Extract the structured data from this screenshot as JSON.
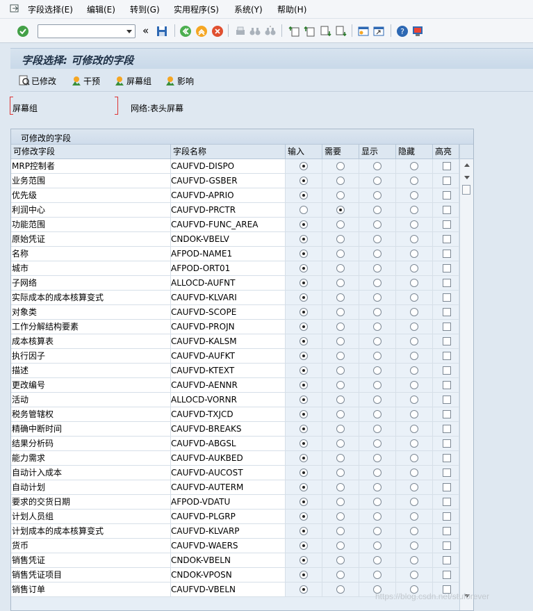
{
  "menubar": {
    "items": [
      "字段选择(E)",
      "编辑(E)",
      "转到(G)",
      "实用程序(S)",
      "系统(Y)",
      "帮助(H)"
    ]
  },
  "toolbar": {
    "command_value": ""
  },
  "title": "字段选择: 可修改的字段",
  "app_toolbar": {
    "items": [
      "已修改",
      "干预",
      "屏幕组",
      "影响"
    ]
  },
  "field": {
    "label": "屏幕组",
    "value": "网络:表头屏幕"
  },
  "table": {
    "group_title": "可修改的字段",
    "columns": [
      "可修改字段",
      "字段名称",
      "输入",
      "需要",
      "显示",
      "隐藏",
      "高亮"
    ],
    "rows": [
      {
        "desc": "MRP控制者",
        "name": "CAUFVD-DISPO",
        "sel": "input",
        "highlight": false
      },
      {
        "desc": "业务范围",
        "name": "CAUFVD-GSBER",
        "sel": "input",
        "highlight": false
      },
      {
        "desc": "优先级",
        "name": "CAUFVD-APRIO",
        "sel": "input",
        "highlight": false
      },
      {
        "desc": "利润中心",
        "name": "CAUFVD-PRCTR",
        "sel": "required",
        "highlight": false
      },
      {
        "desc": "功能范围",
        "name": "CAUFVD-FUNC_AREA",
        "sel": "input",
        "highlight": false
      },
      {
        "desc": "原始凭证",
        "name": "CNDOK-VBELV",
        "sel": "input",
        "highlight": false
      },
      {
        "desc": "名称",
        "name": "AFPOD-NAME1",
        "sel": "input",
        "highlight": false
      },
      {
        "desc": "城市",
        "name": "AFPOD-ORT01",
        "sel": "input",
        "highlight": false
      },
      {
        "desc": "子网络",
        "name": "ALLOCD-AUFNT",
        "sel": "input",
        "highlight": false
      },
      {
        "desc": "实际成本的成本核算变式",
        "name": "CAUFVD-KLVARI",
        "sel": "input",
        "highlight": false
      },
      {
        "desc": "对象类",
        "name": "CAUFVD-SCOPE",
        "sel": "input",
        "highlight": false
      },
      {
        "desc": "工作分解结构要素",
        "name": "CAUFVD-PROJN",
        "sel": "input",
        "highlight": false
      },
      {
        "desc": "成本核算表",
        "name": "CAUFVD-KALSM",
        "sel": "input",
        "highlight": false
      },
      {
        "desc": "执行因子",
        "name": "CAUFVD-AUFKT",
        "sel": "input",
        "highlight": false
      },
      {
        "desc": "描述",
        "name": "CAUFVD-KTEXT",
        "sel": "input",
        "highlight": false
      },
      {
        "desc": "更改编号",
        "name": "CAUFVD-AENNR",
        "sel": "input",
        "highlight": false
      },
      {
        "desc": "活动",
        "name": "ALLOCD-VORNR",
        "sel": "input",
        "highlight": false
      },
      {
        "desc": "税务管辖权",
        "name": "CAUFVD-TXJCD",
        "sel": "input",
        "highlight": false
      },
      {
        "desc": "精确中断时间",
        "name": "CAUFVD-BREAKS",
        "sel": "input",
        "highlight": false
      },
      {
        "desc": "结果分析码",
        "name": "CAUFVD-ABGSL",
        "sel": "input",
        "highlight": false
      },
      {
        "desc": "能力需求",
        "name": "CAUFVD-AUKBED",
        "sel": "input",
        "highlight": false
      },
      {
        "desc": "自动计入成本",
        "name": "CAUFVD-AUCOST",
        "sel": "input",
        "highlight": false
      },
      {
        "desc": "自动计划",
        "name": "CAUFVD-AUTERM",
        "sel": "input",
        "highlight": false
      },
      {
        "desc": "要求的交货日期",
        "name": "AFPOD-VDATU",
        "sel": "input",
        "highlight": false
      },
      {
        "desc": "计划人员组",
        "name": "CAUFVD-PLGRP",
        "sel": "input",
        "highlight": false
      },
      {
        "desc": "计划成本的成本核算变式",
        "name": "CAUFVD-KLVARP",
        "sel": "input",
        "highlight": false
      },
      {
        "desc": "货币",
        "name": "CAUFVD-WAERS",
        "sel": "input",
        "highlight": false
      },
      {
        "desc": "销售凭证",
        "name": "CNDOK-VBELN",
        "sel": "input",
        "highlight": false
      },
      {
        "desc": "销售凭证项目",
        "name": "CNDOK-VPOSN",
        "sel": "input",
        "highlight": false
      },
      {
        "desc": "销售订单",
        "name": "CAUFVD-VBELN",
        "sel": "input",
        "highlight": false
      }
    ]
  },
  "watermark": "https://blog.csdn.net/stuforever"
}
